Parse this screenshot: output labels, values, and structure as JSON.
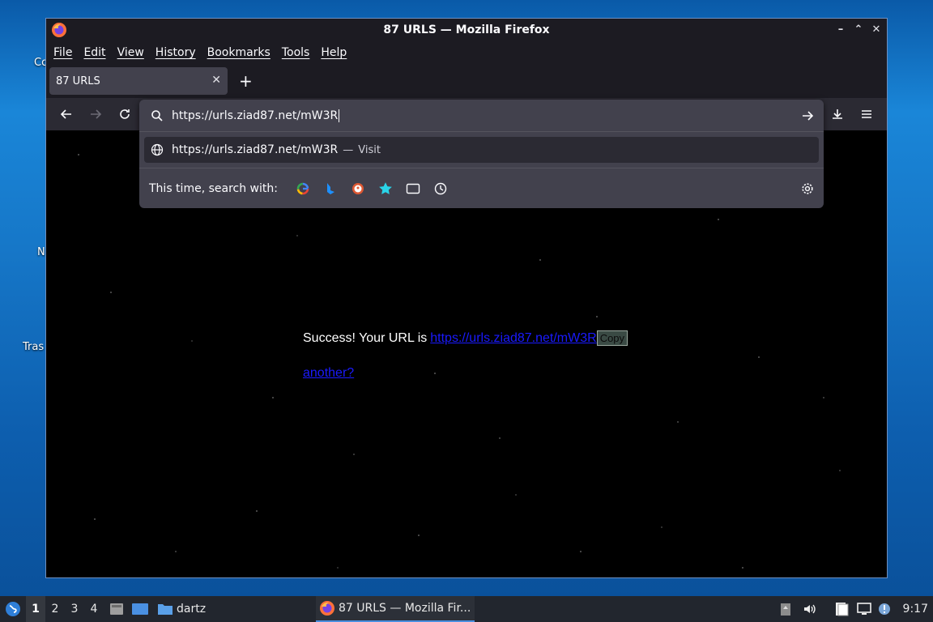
{
  "desktop": {
    "icon_labels": [
      "Co",
      "N",
      "Tras"
    ]
  },
  "window": {
    "title": "87 URLS — Mozilla Firefox",
    "controls": [
      "–",
      "⌃",
      "✕"
    ]
  },
  "menu": [
    "File",
    "Edit",
    "View",
    "History",
    "Bookmarks",
    "Tools",
    "Help"
  ],
  "tabs": [
    {
      "label": "87 URLS",
      "close": "✕"
    }
  ],
  "new_tab": "+",
  "urlbar": {
    "value": "https://urls.ziad87.net/mW3R"
  },
  "suggestion": {
    "url": "https://urls.ziad87.net/mW3R",
    "sep": "—",
    "action": "Visit"
  },
  "search_with": {
    "label": "This time, search with:",
    "engines": [
      "google-icon",
      "bing-icon",
      "duckduckgo-icon",
      "bookmarks-icon",
      "tabs-icon",
      "history-icon"
    ]
  },
  "page": {
    "success_text": "Success! Your URL is",
    "short_url": "https://urls.ziad87.net/mW3R",
    "copy_label": "Copy",
    "another_link": "another?"
  },
  "taskbar": {
    "workspaces": [
      "1",
      "2",
      "3",
      "4"
    ],
    "active_workspace": "1",
    "folder_label": "dartz",
    "task_label": "87 URLS — Mozilla Fir...",
    "clock": "9:17"
  },
  "colors": {
    "accent": "#4a8fe0",
    "link": "#1a1aff"
  }
}
